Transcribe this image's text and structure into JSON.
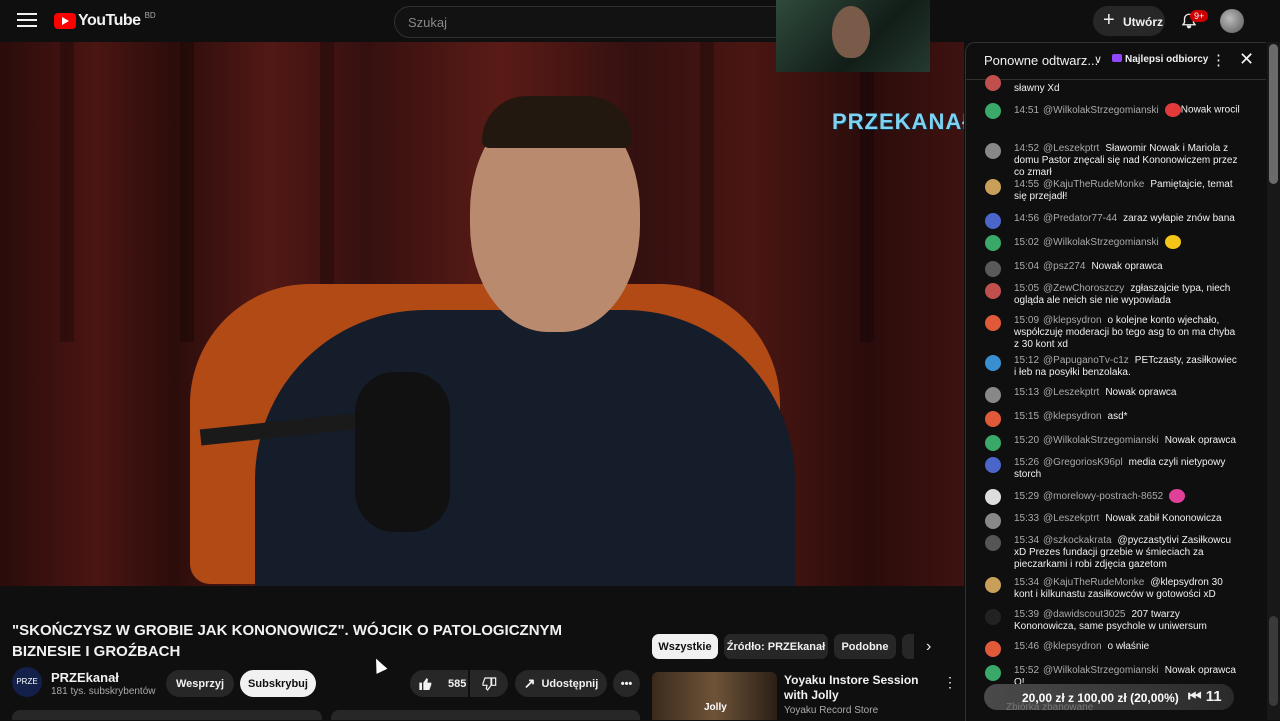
{
  "header": {
    "logo_text": "YouTube",
    "country_code": "BD",
    "search_placeholder": "Szukaj",
    "create_label": "Utwórz",
    "notification_count": "9+"
  },
  "video": {
    "overlay_logo": "PRZEKANAŁ"
  },
  "details": {
    "title": "\"SKOŃCZYSZ W GROBIE JAK KONONOWICZ\". WÓJCIK O PATOLOGICZNYM BIZNESIE I GROŹBACH",
    "channel_name": "PRZEkanał",
    "channel_avatar_text": "PRZE",
    "subscribers": "181 tys. subskrybentów",
    "support_label": "Wesprzyj",
    "subscribe_label": "Subskrybuj",
    "like_count": "585",
    "share_label": "Udostępnij"
  },
  "chips": [
    "Wszystkie",
    "Źródło: PRZEkanał",
    "Podobne"
  ],
  "recommendation": {
    "title": "Yoyaku Instore Session with Jolly",
    "channel": "Yoyaku Record Store",
    "thumb_text": "Jolly"
  },
  "chat": {
    "title": "Ponowne odtwarz...",
    "top_fans": "Najlepsi odbiorcy",
    "messages": [
      {
        "time": "14:51",
        "author": "@WilkolakStrzegomianski",
        "text": "Nowak wrocil"
      },
      {
        "time": "14:52",
        "author": "@Leszekptrt",
        "text": "Sławomir Nowak i Mariola z domu Pastor znęcali się nad Kononowiczem przez co zmarł"
      },
      {
        "time": "14:55",
        "author": "@KajuTheRudeMonke",
        "text": "Pamiętajcie, temat się przejadł!"
      },
      {
        "time": "14:56",
        "author": "@Predator77-44",
        "text": "zaraz wyłapie znów bana"
      },
      {
        "time": "15:02",
        "author": "@WilkolakStrzegomianski",
        "text": ""
      },
      {
        "time": "15:04",
        "author": "@psz274",
        "text": "Nowak oprawca"
      },
      {
        "time": "15:05",
        "author": "@ZewChoroszczy",
        "text": "zgłaszajcie typa, niech ogląda ale neich sie nie wypowiada"
      },
      {
        "time": "15:09",
        "author": "@klepsydron",
        "text": "o kolejne konto wjechało, współczuję moderacji bo tego asg to on ma chyba z 30 kont xd"
      },
      {
        "time": "15:12",
        "author": "@PapuganoTv-c1z",
        "text": "PETczasty, zasiłkowiec i łeb na posyłki benzolaka."
      },
      {
        "time": "15:13",
        "author": "@Leszekptrt",
        "text": "Nowak oprawca"
      },
      {
        "time": "15:15",
        "author": "@klepsydron",
        "text": "asd*"
      },
      {
        "time": "15:20",
        "author": "@WilkolakStrzegomianski",
        "text": "Nowak oprawca"
      },
      {
        "time": "15:26",
        "author": "@GregoriosK96pl",
        "text": "media czyli nietypowy storch"
      },
      {
        "time": "15:29",
        "author": "@morelowy-postrach-8652",
        "text": ""
      },
      {
        "time": "15:33",
        "author": "@Leszekptrt",
        "text": "Nowak zabił Kononowicza"
      },
      {
        "time": "15:34",
        "author": "@szkockakrata",
        "text": "@pyczastytivi Zasiłkowcu xD Prezes fundacji grzebie w śmieciach za pieczarkami i robi zdjęcia gazetom"
      },
      {
        "time": "15:34",
        "author": "@KajuTheRudeMonke",
        "text": "@klepsydron 30 kont i kilkunastu zasiłkowców w gotowości xD"
      },
      {
        "time": "15:39",
        "author": "@dawidscout3025",
        "text": "207 twarzy Kononowicza, same psychole w uniwersum"
      },
      {
        "time": "15:46",
        "author": "@klepsydron",
        "text": "o właśnie"
      },
      {
        "time": "15:52",
        "author": "@WilkolakStrzegomianski",
        "text": "Nowak oprawca O!"
      }
    ],
    "top_partial_text": "sławny Xd",
    "superchat_text": "20,00 zł z 100,00 zł (20,00%)",
    "superchat_sub": "Zbiórka zbanowane",
    "superchat_count": "11"
  },
  "colors": {
    "background": "#0f0f0f",
    "brand_red": "#ff0000",
    "chair": "#b24a16",
    "overlay_logo": "#7ed3f2"
  }
}
